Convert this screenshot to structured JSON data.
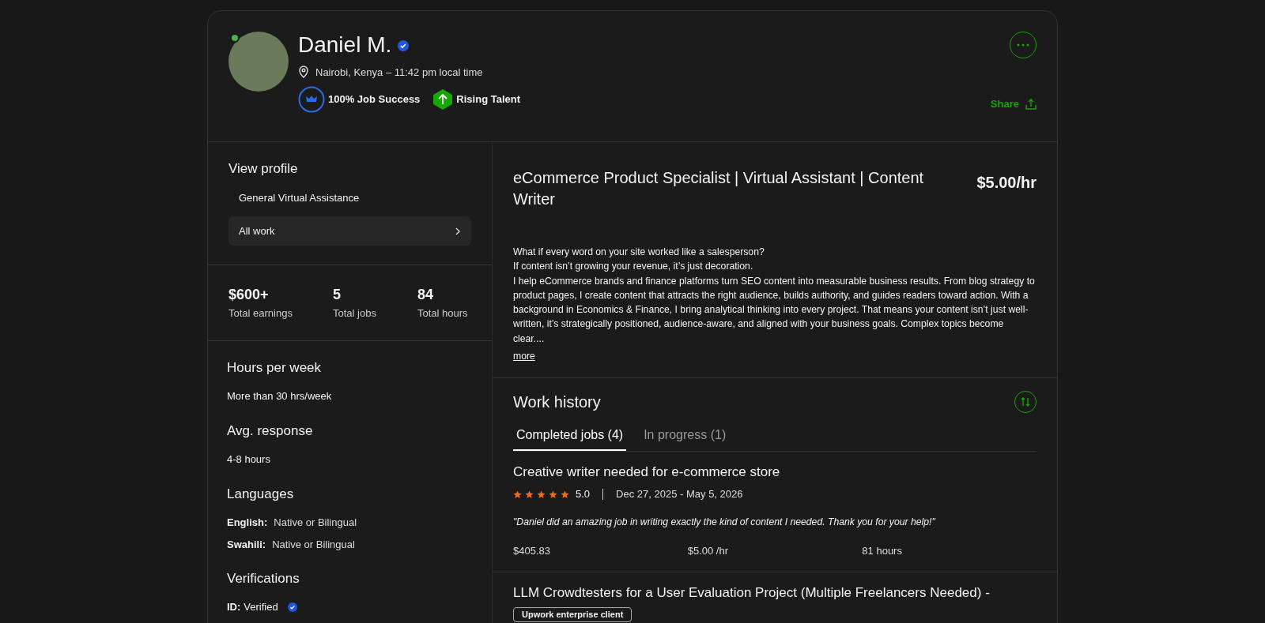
{
  "profile": {
    "name": "Daniel M.",
    "online": true,
    "verified": true,
    "location": "Nairobi, Kenya – 11:42 pm local time",
    "badges": [
      {
        "kind": "job-success",
        "label": "100% Job Success"
      },
      {
        "kind": "rising-talent",
        "label": "Rising Talent"
      }
    ],
    "share": "Share"
  },
  "sidebar": {
    "view_profile": {
      "title": "View profile",
      "items": [
        {
          "label": "General Virtual Assistance",
          "selected": false
        },
        {
          "label": "All work",
          "selected": true
        }
      ]
    },
    "stats": [
      {
        "value": "$600+",
        "label": "Total earnings"
      },
      {
        "value": "5",
        "label": "Total jobs"
      },
      {
        "value": "84",
        "label": "Total hours"
      }
    ],
    "sections": [
      {
        "kind": "text",
        "title": "Hours per week",
        "text": "More than 30 hrs/week"
      },
      {
        "kind": "text",
        "title": "Avg. response",
        "text": "4-8 hours"
      },
      {
        "kind": "languages",
        "title": "Languages",
        "items": [
          {
            "name": "English:",
            "level": "Native or Bilingual"
          },
          {
            "name": "Swahili:",
            "level": "Native or Bilingual"
          }
        ]
      },
      {
        "kind": "verifications",
        "title": "Verifications",
        "items": [
          {
            "label": "ID:",
            "value": "Verified",
            "verified": true
          }
        ]
      }
    ]
  },
  "overview": {
    "title": "eCommerce Product Specialist | Virtual Assistant | Content Writer",
    "rate": "$5.00/hr",
    "paragraphs": [
      "What if every word on your site worked like a salesperson?",
      "If content isn’t growing your revenue, it’s just decoration.",
      "I help eCommerce brands and finance platforms turn SEO content into measurable business results. From blog strategy to product pages, I create content that attracts the right audience, builds authority, and guides readers toward action. With a background in Economics & Finance, I bring analytical thinking into every project. That means your content isn’t just well-written, it’s strategically positioned, audience-aware, and aligned with your business goals. Complex topics become clear...."
    ],
    "more": "more"
  },
  "work_history": {
    "title": "Work history",
    "tabs": [
      {
        "label": "Completed jobs (4)",
        "selected": true
      },
      {
        "label": "In progress (1)",
        "selected": false
      }
    ],
    "jobs": [
      {
        "title": "Creative writer needed for e-commerce store",
        "stars": 5,
        "rating": "5.0",
        "dates": "Dec 27, 2025 - May 5, 2026",
        "feedback": "\"Daniel did an amazing job in writing exactly the kind of content I needed. Thank you for your help!\"",
        "earned": "$405.83",
        "rate": "$5.00 /hr",
        "hours": "81 hours"
      },
      {
        "title": "LLM Crowdtesters for a User Evaluation Project (Multiple Freelancers Needed) -",
        "tag": "Upwork enterprise client"
      }
    ]
  }
}
